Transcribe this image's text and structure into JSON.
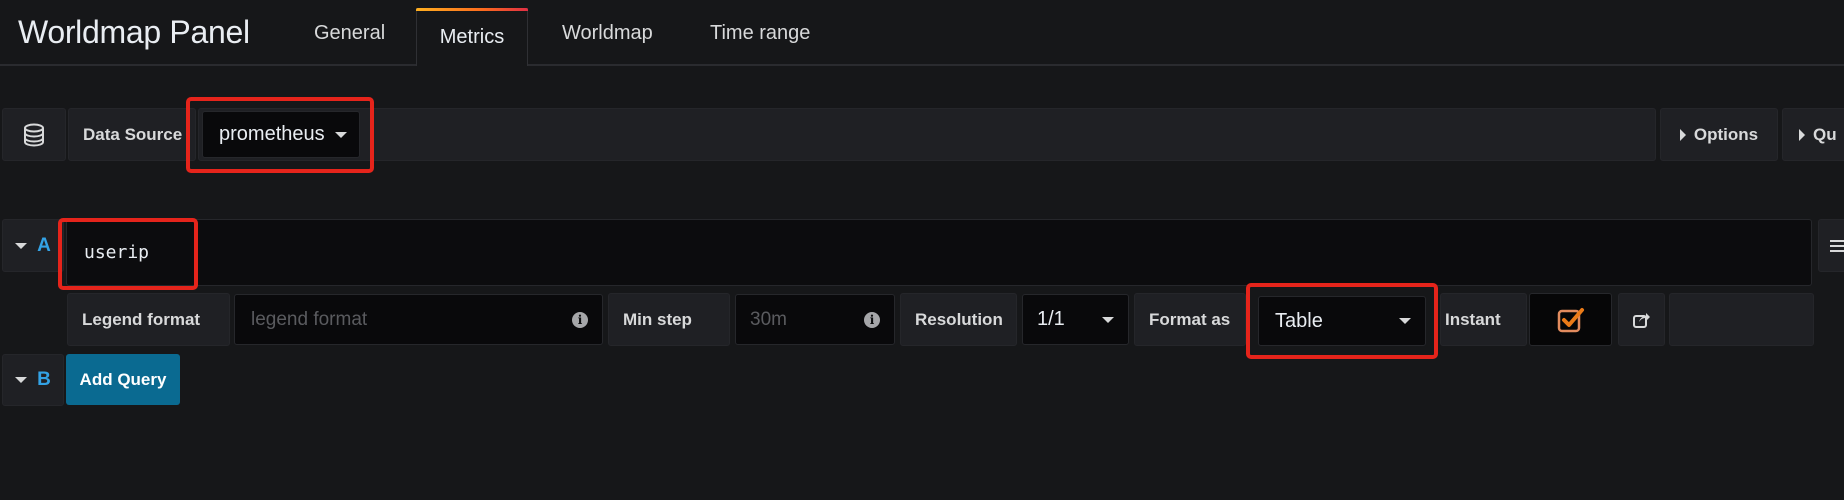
{
  "header": {
    "title": "Worldmap Panel",
    "tabs": [
      {
        "label": "General",
        "active": false
      },
      {
        "label": "Metrics",
        "active": true
      },
      {
        "label": "Worldmap",
        "active": false
      },
      {
        "label": "Time range",
        "active": false
      }
    ]
  },
  "datasource_row": {
    "icon": "database-icon",
    "label": "Data Source",
    "selected": "prometheus",
    "options_button": "Options",
    "query_inspector_button": "Qu"
  },
  "queries": [
    {
      "ref_id": "A",
      "expression": "userip",
      "legend_format_label": "Legend format",
      "legend_format_placeholder": "legend format",
      "min_step_label": "Min step",
      "min_step_placeholder": "30m",
      "resolution_label": "Resolution",
      "resolution_value": "1/1",
      "format_as_label": "Format as",
      "format_as_value": "Table",
      "instant_label": "Instant",
      "instant_checked": true
    }
  ],
  "add_query": {
    "ref_id": "B",
    "label": "Add Query"
  },
  "colors": {
    "accent_gradient_start": "#ffb020",
    "accent_gradient_end": "#e02f44",
    "ref_id": "#33a2e5",
    "add_query_bg": "#0a6a91",
    "checkbox": "#eb7b18",
    "highlight_annotation": "#e5241b"
  }
}
